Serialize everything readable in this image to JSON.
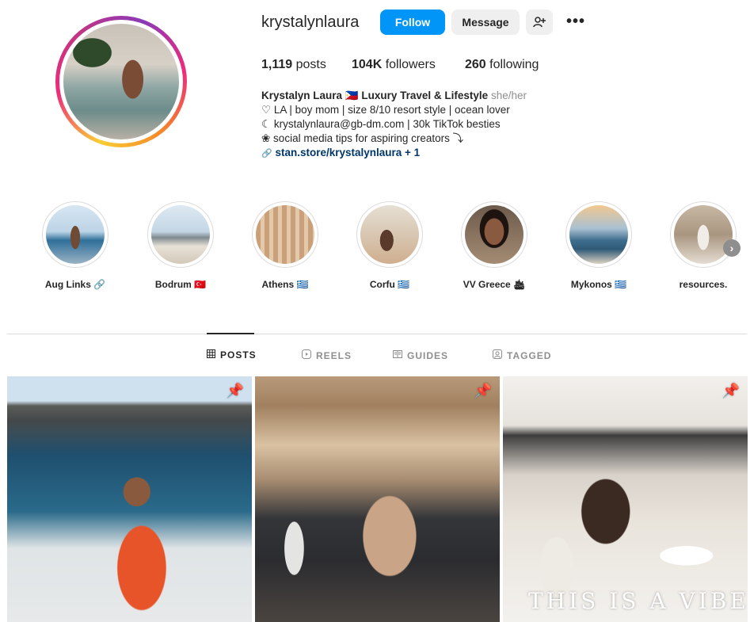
{
  "profile": {
    "username": "krystalynlaura",
    "follow_label": "Follow",
    "message_label": "Message",
    "more_label": "•••",
    "stats": {
      "posts_count": "1,119",
      "posts_label": "posts",
      "followers_count": "104K",
      "followers_label": "followers",
      "following_count": "260",
      "following_label": "following"
    },
    "bio": {
      "name": "Krystalyn Laura 🇵🇭 Luxury Travel & Lifestyle",
      "pronouns": "she/her",
      "line1": "♡ LA | boy mom | size 8/10 resort style | ocean lover",
      "line2": "☾ krystalynlaura@gb-dm.com | 30k TikTok besties",
      "line3": "❀ social media tips for aspiring creators ⤵",
      "link": "stan.store/krystalynlaura + 1",
      "link_icon": "🔗"
    }
  },
  "highlights": [
    {
      "label": "Aug Links 🔗"
    },
    {
      "label": "Bodrum 🇹🇷"
    },
    {
      "label": "Athens 🇬🇷"
    },
    {
      "label": "Corfu 🇬🇷"
    },
    {
      "label": "VV Greece 🛳"
    },
    {
      "label": "Mykonos 🇬🇷"
    },
    {
      "label": "resources."
    }
  ],
  "tabs": [
    {
      "label": "POSTS",
      "icon": "grid-icon",
      "active": true
    },
    {
      "label": "REELS",
      "icon": "reels-icon",
      "active": false
    },
    {
      "label": "GUIDES",
      "icon": "guides-icon",
      "active": false
    },
    {
      "label": "TAGGED",
      "icon": "tagged-icon",
      "active": false
    }
  ],
  "posts": [
    {
      "pinned": true
    },
    {
      "pinned": true
    },
    {
      "pinned": true,
      "caption": "THIS IS A VIBE"
    }
  ],
  "colors": {
    "accent": "#0095f6",
    "text": "#262626",
    "muted": "#8e8e8e",
    "link": "#00376b"
  }
}
